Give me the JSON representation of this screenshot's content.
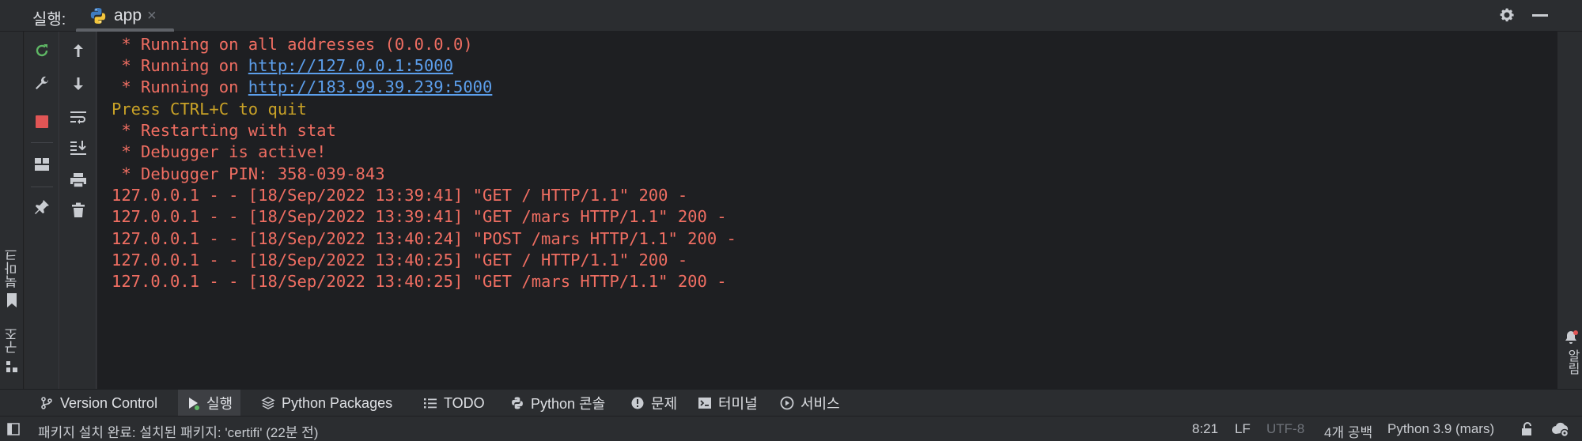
{
  "header": {
    "run_label": "실행:",
    "tab_label": "app",
    "tab_close": "×"
  },
  "left_stripe": {
    "bookmarks_label": "북마크",
    "structure_label": "구조"
  },
  "console": {
    "lines": [
      {
        "prefix": " * Running on all addresses (0.0.0.0)",
        "link": ""
      },
      {
        "prefix": " * Running on ",
        "link": "http://127.0.0.1:5000"
      },
      {
        "prefix": " * Running on ",
        "link": "http://183.99.39.239:5000"
      },
      {
        "prefix": "Press CTRL+C to quit",
        "link": ""
      },
      {
        "prefix": " * Restarting with stat",
        "link": ""
      },
      {
        "prefix": " * Debugger is active!",
        "link": ""
      },
      {
        "prefix": " * Debugger PIN: 358-039-843",
        "link": ""
      },
      {
        "prefix": "127.0.0.1 - - [18/Sep/2022 13:39:41] \"GET / HTTP/1.1\" 200 -",
        "link": ""
      },
      {
        "prefix": "127.0.0.1 - - [18/Sep/2022 13:39:41] \"GET /mars HTTP/1.1\" 200 -",
        "link": ""
      },
      {
        "prefix": "127.0.0.1 - - [18/Sep/2022 13:40:24] \"POST /mars HTTP/1.1\" 200 -",
        "link": ""
      },
      {
        "prefix": "127.0.0.1 - - [18/Sep/2022 13:40:25] \"GET / HTTP/1.1\" 200 -",
        "link": ""
      },
      {
        "prefix": "127.0.0.1 - - [18/Sep/2022 13:40:25] \"GET /mars HTTP/1.1\" 200 -",
        "link": ""
      }
    ]
  },
  "right_stripe": {
    "notifications_label": "알림"
  },
  "bottom_tabs": [
    {
      "label": "Version Control",
      "icon": "branch-icon"
    },
    {
      "label": "실행",
      "icon": "run-icon"
    },
    {
      "label": "Python Packages",
      "icon": "packages-icon"
    },
    {
      "label": "TODO",
      "icon": "todo-icon"
    },
    {
      "label": "Python 콘솔",
      "icon": "python-console-icon"
    },
    {
      "label": "문제",
      "icon": "problems-icon"
    },
    {
      "label": "터미널",
      "icon": "terminal-icon"
    },
    {
      "label": "서비스",
      "icon": "services-icon"
    }
  ],
  "status": {
    "message": "패키지 설치 완료: 설치된 패키지: 'certifi' (22분 전)",
    "position": "8:21",
    "line_sep": "LF",
    "encoding": "UTF-8",
    "indent": "4개 공백",
    "interpreter": "Python 3.9 (mars)"
  },
  "colors": {
    "console_red": "#f06e62",
    "console_yellow": "#c9a227",
    "link_blue": "#5c9fec",
    "rerun_green": "#5fb865",
    "stop_red": "#e05555"
  }
}
